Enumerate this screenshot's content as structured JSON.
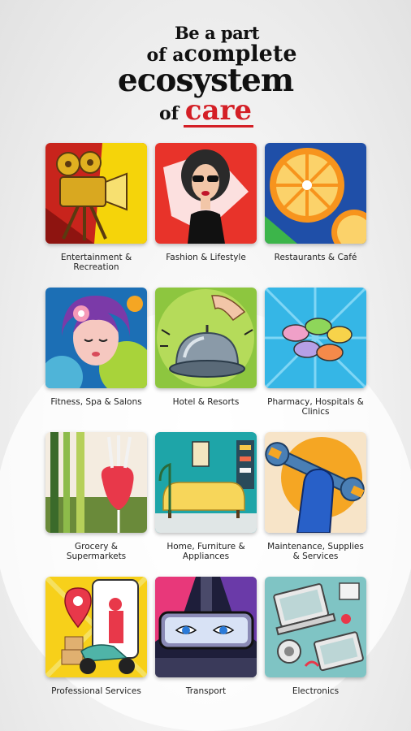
{
  "header": {
    "line1": "Be a part",
    "line2_prefix": "of a",
    "line2_big": "complete",
    "line3": "ecosystem",
    "line4_prefix": "of",
    "line4_highlight": "care"
  },
  "colors": {
    "accent": "#d41f26",
    "text": "#111111"
  },
  "categories": [
    {
      "label": "Entertainment & Recreation",
      "icon": "film-camera-icon"
    },
    {
      "label": "Fashion & Lifestyle",
      "icon": "fashion-woman-icon"
    },
    {
      "label": "Restaurants & Café",
      "icon": "orange-slice-icon"
    },
    {
      "label": "Fitness, Spa & Salons",
      "icon": "spa-woman-icon"
    },
    {
      "label": "Hotel & Resorts",
      "icon": "service-bell-icon"
    },
    {
      "label": "Pharmacy, Hospitals & Clinics",
      "icon": "pills-icon"
    },
    {
      "label": "Grocery & Supermarkets",
      "icon": "radish-icon"
    },
    {
      "label": "Home, Furniture & Appliances",
      "icon": "sofa-icon"
    },
    {
      "label": "Maintenance, Supplies & Services",
      "icon": "wrench-hand-icon"
    },
    {
      "label": "Professional Services",
      "icon": "delivery-scooter-icon"
    },
    {
      "label": "Transport",
      "icon": "car-mirror-eyes-icon"
    },
    {
      "label": "Electronics",
      "icon": "laptop-gadgets-icon"
    }
  ]
}
